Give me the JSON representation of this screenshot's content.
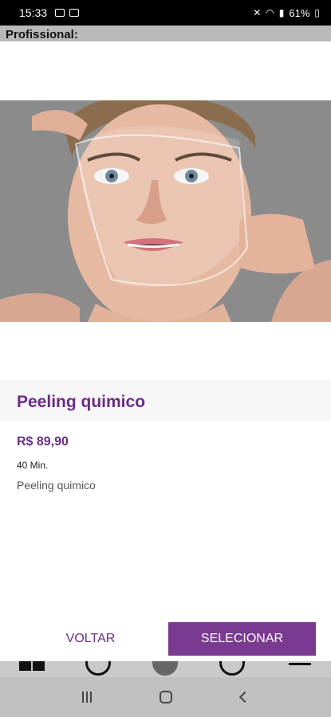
{
  "status_bar": {
    "time": "15:33",
    "battery": "61%",
    "icons": [
      "image-icon",
      "sim-icon",
      "mute-icon",
      "wifi-icon",
      "signal-icon",
      "battery-icon"
    ]
  },
  "header": {
    "label": "Profissional:"
  },
  "service": {
    "title": "Peeling quimico",
    "price": "R$ 89,90",
    "duration": "40 Min.",
    "description": "Peeling quimico"
  },
  "actions": {
    "back_label": "VOLTAR",
    "select_label": "SELECIONAR"
  },
  "colors": {
    "accent": "#6b2c86",
    "button": "#7a3a91"
  }
}
